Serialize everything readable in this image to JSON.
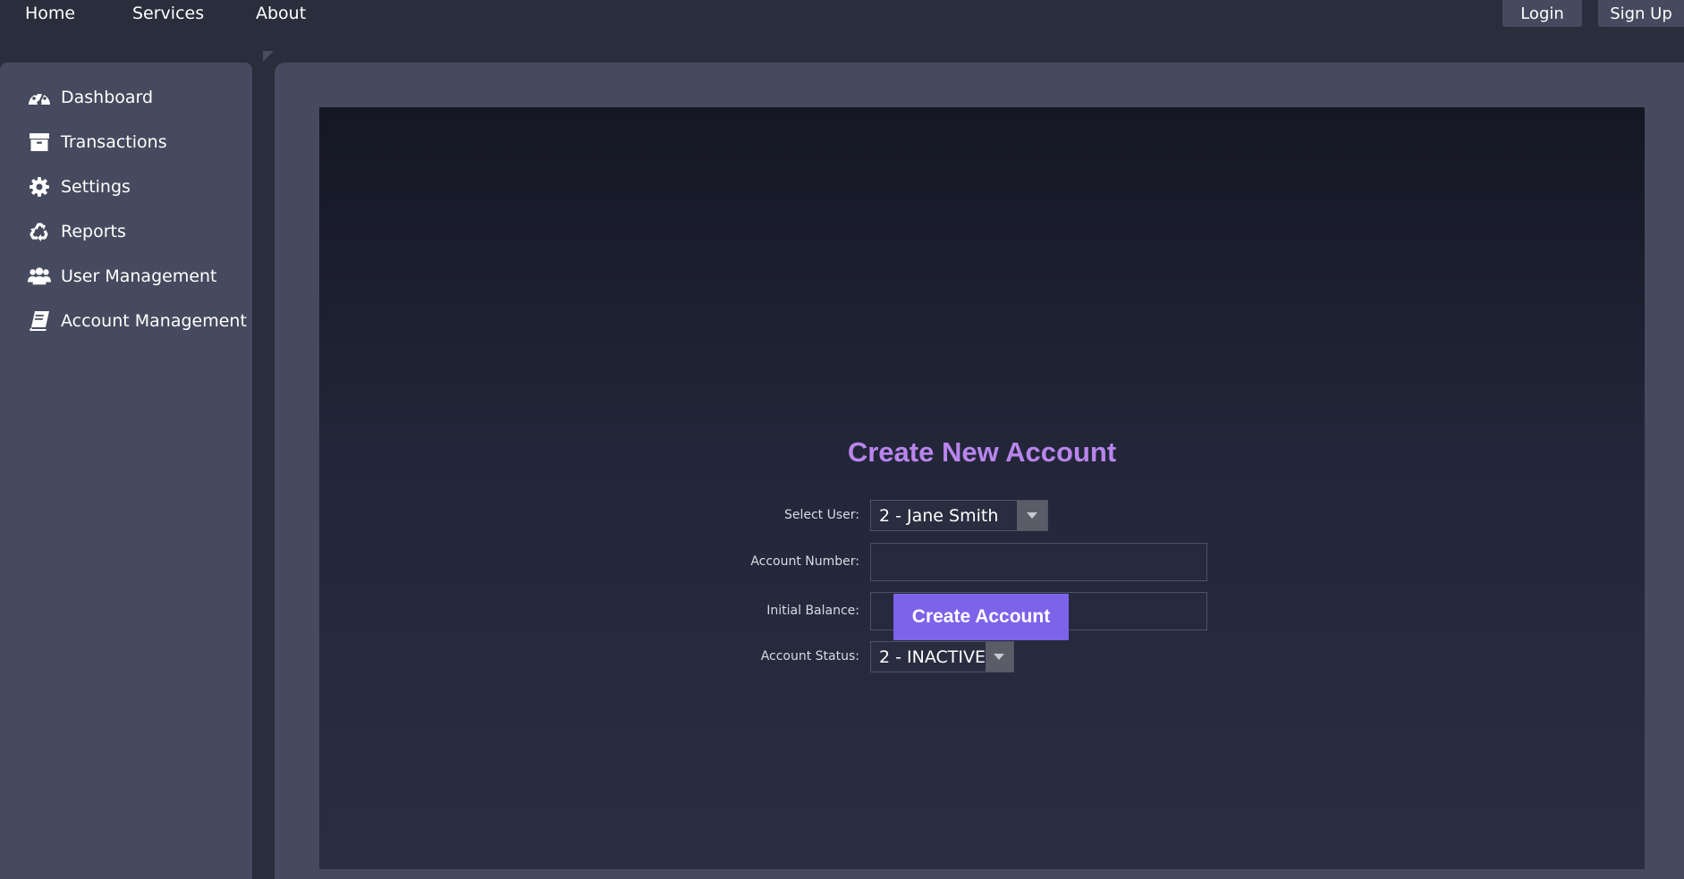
{
  "topnav": {
    "links": [
      "Home",
      "Services",
      "About"
    ],
    "login_label": "Login",
    "signup_label": "Sign Up"
  },
  "sidebar": {
    "items": [
      {
        "label": "Dashboard",
        "icon": "dashboard-gauge-icon"
      },
      {
        "label": "Transactions",
        "icon": "archive-box-icon"
      },
      {
        "label": "Settings",
        "icon": "gear-icon"
      },
      {
        "label": "Reports",
        "icon": "recycle-icon"
      },
      {
        "label": "User Management",
        "icon": "users-icon"
      },
      {
        "label": "Account Management",
        "icon": "book-icon"
      }
    ]
  },
  "form": {
    "title": "Create New Account",
    "select_user_label": "Select User:",
    "select_user_value": "2 - Jane Smith",
    "account_number_label": "Account Number:",
    "account_number_value": "",
    "initial_balance_label": "Initial Balance:",
    "initial_balance_value": "",
    "account_status_label": "Account Status:",
    "account_status_value": "2 - INACTIVE",
    "submit_label": "Create Account"
  },
  "colors": {
    "accent": "#7c63ea",
    "title": "#b985ec",
    "background": "#2a2d3c",
    "panel": "#464a5e"
  }
}
